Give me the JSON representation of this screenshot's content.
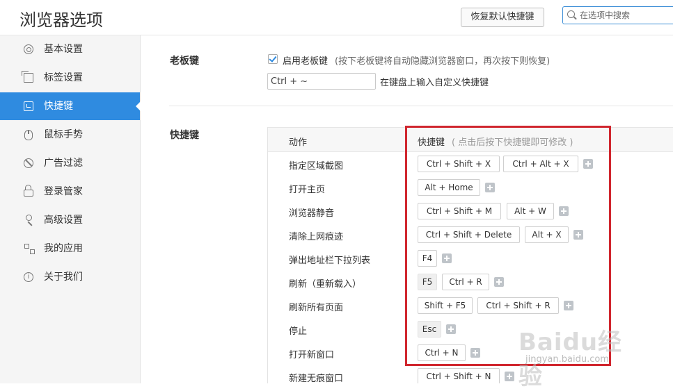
{
  "header": {
    "title": "浏览器选项",
    "restore_button": "恢复默认快捷键",
    "search_placeholder": "在选项中搜索"
  },
  "sidebar": {
    "items": [
      {
        "label": "基本设置",
        "icon": "gear-icon"
      },
      {
        "label": "标签设置",
        "icon": "tabs-icon"
      },
      {
        "label": "快捷键",
        "icon": "keyboard-icon",
        "active": true
      },
      {
        "label": "鼠标手势",
        "icon": "mouse-icon"
      },
      {
        "label": "广告过滤",
        "icon": "block-icon"
      },
      {
        "label": "登录管家",
        "icon": "lock-icon"
      },
      {
        "label": "高级设置",
        "icon": "wrench-icon"
      },
      {
        "label": "我的应用",
        "icon": "apps-icon"
      },
      {
        "label": "关于我们",
        "icon": "info-icon"
      }
    ]
  },
  "boss_key": {
    "section_label": "老板键",
    "enable_label": "启用老板键",
    "enable_checked": true,
    "enable_desc": "(按下老板键将自动隐藏浏览器窗口，再次按下则恢复)",
    "input_value": "Ctrl + ~",
    "input_hint": "在键盘上输入自定义快捷键"
  },
  "shortcuts": {
    "section_label": "快捷键",
    "col_action": "动作",
    "col_keys": "快捷键",
    "col_keys_note": "( 点击后按下快捷键即可修改 )",
    "rows": [
      {
        "action": "指定区域截图",
        "keys": [
          "Ctrl  +  Shift  +  X",
          "Ctrl  +  Alt  +  X"
        ]
      },
      {
        "action": "打开主页",
        "keys": [
          "Alt  +  Home"
        ]
      },
      {
        "action": "浏览器静音",
        "keys": [
          "Ctrl  +  Shift  +  M",
          "Alt  +  W"
        ]
      },
      {
        "action": "清除上网痕迹",
        "keys": [
          "Ctrl  +  Shift  +  Delete",
          "Alt  +  X"
        ]
      },
      {
        "action": "弹出地址栏下拉列表",
        "keys": [
          "F4"
        ]
      },
      {
        "action": "刷新（重新载入）",
        "keys": [
          "F5",
          "Ctrl  +  R"
        ]
      },
      {
        "action": "刷新所有页面",
        "keys": [
          "Shift  +  F5",
          "Ctrl  +  Shift  +  R"
        ]
      },
      {
        "action": "停止",
        "keys": [
          "Esc"
        ]
      },
      {
        "action": "打开新窗口",
        "keys": [
          "Ctrl  +  N"
        ]
      },
      {
        "action": "新建无痕窗口",
        "keys": [
          "Ctrl  +  Shift  +  N"
        ]
      }
    ]
  },
  "watermark": {
    "text": "Baidu经验",
    "sub": "jingyan.baidu.com"
  },
  "colors": {
    "accent": "#2f8be0",
    "highlight": "#d0262e"
  }
}
